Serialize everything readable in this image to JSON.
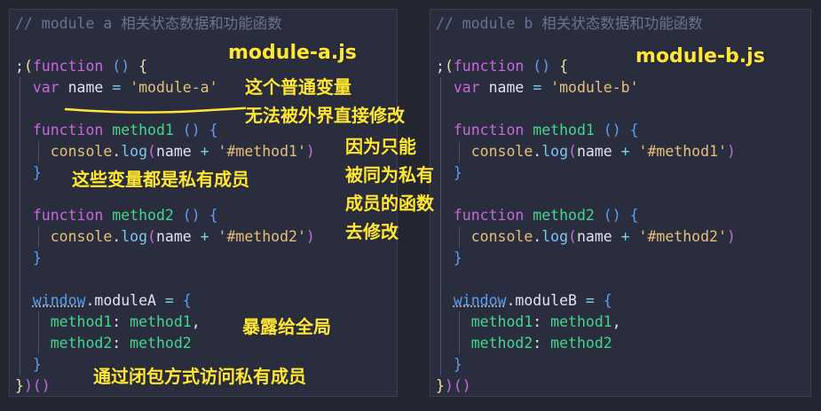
{
  "pane_a": {
    "file_label": "module-a.js",
    "lines": [
      {
        "text": "// module a 相关状态数据和功能函数",
        "style": "cm"
      },
      {
        "text": "",
        "style": "id"
      },
      {
        "tokens": [
          [
            ";",
            "id"
          ],
          [
            "(",
            "pn"
          ],
          [
            "function",
            "kw"
          ],
          [
            " ",
            "id"
          ],
          [
            "()",
            "br"
          ],
          [
            " ",
            "id"
          ],
          [
            "{",
            "pn"
          ]
        ]
      },
      {
        "tokens": [
          [
            "  ",
            "id"
          ],
          [
            "var",
            "kw"
          ],
          [
            " ",
            "id"
          ],
          [
            "name",
            "id"
          ],
          [
            " ",
            "id"
          ],
          [
            "=",
            "op"
          ],
          [
            " ",
            "id"
          ],
          [
            "'module-a'",
            "st"
          ]
        ]
      },
      {
        "text": "",
        "style": "id"
      },
      {
        "tokens": [
          [
            "  ",
            "id"
          ],
          [
            "function",
            "kw"
          ],
          [
            " ",
            "id"
          ],
          [
            "method1",
            "fn"
          ],
          [
            " ",
            "id"
          ],
          [
            "()",
            "br"
          ],
          [
            " ",
            "id"
          ],
          [
            "{",
            "br"
          ]
        ]
      },
      {
        "tokens": [
          [
            "    ",
            "id"
          ],
          [
            "console",
            "ob"
          ],
          [
            ".",
            "id"
          ],
          [
            "log",
            "pr"
          ],
          [
            "(",
            "pm"
          ],
          [
            "name",
            "id"
          ],
          [
            " ",
            "id"
          ],
          [
            "+",
            "op"
          ],
          [
            " ",
            "id"
          ],
          [
            "'#method1'",
            "st"
          ],
          [
            ")",
            "pm"
          ]
        ]
      },
      {
        "tokens": [
          [
            "  ",
            "id"
          ],
          [
            "}",
            "br"
          ]
        ]
      },
      {
        "text": "",
        "style": "id"
      },
      {
        "tokens": [
          [
            "  ",
            "id"
          ],
          [
            "function",
            "kw"
          ],
          [
            " ",
            "id"
          ],
          [
            "method2",
            "fn"
          ],
          [
            " ",
            "id"
          ],
          [
            "()",
            "br"
          ],
          [
            " ",
            "id"
          ],
          [
            "{",
            "br"
          ]
        ]
      },
      {
        "tokens": [
          [
            "    ",
            "id"
          ],
          [
            "console",
            "ob"
          ],
          [
            ".",
            "id"
          ],
          [
            "log",
            "pr"
          ],
          [
            "(",
            "pm"
          ],
          [
            "name",
            "id"
          ],
          [
            " ",
            "id"
          ],
          [
            "+",
            "op"
          ],
          [
            " ",
            "id"
          ],
          [
            "'#method2'",
            "st"
          ],
          [
            ")",
            "pm"
          ]
        ]
      },
      {
        "tokens": [
          [
            "  ",
            "id"
          ],
          [
            "}",
            "br"
          ]
        ]
      },
      {
        "text": "",
        "style": "id"
      },
      {
        "tokens": [
          [
            "  ",
            "id"
          ],
          [
            "window",
            "br"
          ],
          [
            ".",
            "id"
          ],
          [
            "moduleA",
            "id"
          ],
          [
            " ",
            "id"
          ],
          [
            "=",
            "op"
          ],
          [
            " ",
            "id"
          ],
          [
            "{",
            "br"
          ]
        ]
      },
      {
        "tokens": [
          [
            "    ",
            "id"
          ],
          [
            "method1",
            "fn"
          ],
          [
            ":",
            "id"
          ],
          [
            " ",
            "id"
          ],
          [
            "method1",
            "fn"
          ],
          [
            ",",
            "id"
          ]
        ]
      },
      {
        "tokens": [
          [
            "    ",
            "id"
          ],
          [
            "method2",
            "fn"
          ],
          [
            ":",
            "id"
          ],
          [
            " ",
            "id"
          ],
          [
            "method2",
            "fn"
          ]
        ]
      },
      {
        "tokens": [
          [
            "  ",
            "id"
          ],
          [
            "}",
            "br"
          ]
        ]
      },
      {
        "tokens": [
          [
            "}",
            "pn"
          ],
          [
            ")()",
            "pm"
          ]
        ]
      }
    ],
    "annotations": {
      "plain_var": "这个普通变量",
      "no_direct_edit": "无法被外界直接修改",
      "private_members": "这些变量都是私有成员",
      "only_by_private": "因为只能\n被同为私有\n成员的函数\n去修改",
      "expose_global": "暴露给全局",
      "closure_access": "通过闭包方式访问私有成员"
    }
  },
  "pane_b": {
    "file_label": "module-b.js",
    "lines": [
      {
        "text": "// module b 相关状态数据和功能函数",
        "style": "cm"
      },
      {
        "text": "",
        "style": "id"
      },
      {
        "tokens": [
          [
            ";",
            "id"
          ],
          [
            "(",
            "pn"
          ],
          [
            "function",
            "kw"
          ],
          [
            " ",
            "id"
          ],
          [
            "()",
            "br"
          ],
          [
            " ",
            "id"
          ],
          [
            "{",
            "pn"
          ]
        ]
      },
      {
        "tokens": [
          [
            "  ",
            "id"
          ],
          [
            "var",
            "kw"
          ],
          [
            " ",
            "id"
          ],
          [
            "name",
            "id"
          ],
          [
            " ",
            "id"
          ],
          [
            "=",
            "op"
          ],
          [
            " ",
            "id"
          ],
          [
            "'module-b'",
            "st"
          ]
        ]
      },
      {
        "text": "",
        "style": "id"
      },
      {
        "tokens": [
          [
            "  ",
            "id"
          ],
          [
            "function",
            "kw"
          ],
          [
            " ",
            "id"
          ],
          [
            "method1",
            "fn"
          ],
          [
            " ",
            "id"
          ],
          [
            "()",
            "br"
          ],
          [
            " ",
            "id"
          ],
          [
            "{",
            "br"
          ]
        ]
      },
      {
        "tokens": [
          [
            "    ",
            "id"
          ],
          [
            "console",
            "ob"
          ],
          [
            ".",
            "id"
          ],
          [
            "log",
            "pr"
          ],
          [
            "(",
            "pm"
          ],
          [
            "name",
            "id"
          ],
          [
            " ",
            "id"
          ],
          [
            "+",
            "op"
          ],
          [
            " ",
            "id"
          ],
          [
            "'#method1'",
            "st"
          ],
          [
            ")",
            "pm"
          ]
        ]
      },
      {
        "tokens": [
          [
            "  ",
            "id"
          ],
          [
            "}",
            "br"
          ]
        ]
      },
      {
        "text": "",
        "style": "id"
      },
      {
        "tokens": [
          [
            "  ",
            "id"
          ],
          [
            "function",
            "kw"
          ],
          [
            " ",
            "id"
          ],
          [
            "method2",
            "fn"
          ],
          [
            " ",
            "id"
          ],
          [
            "()",
            "br"
          ],
          [
            " ",
            "id"
          ],
          [
            "{",
            "br"
          ]
        ]
      },
      {
        "tokens": [
          [
            "    ",
            "id"
          ],
          [
            "console",
            "ob"
          ],
          [
            ".",
            "id"
          ],
          [
            "log",
            "pr"
          ],
          [
            "(",
            "pm"
          ],
          [
            "name",
            "id"
          ],
          [
            " ",
            "id"
          ],
          [
            "+",
            "op"
          ],
          [
            " ",
            "id"
          ],
          [
            "'#method2'",
            "st"
          ],
          [
            ")",
            "pm"
          ]
        ]
      },
      {
        "tokens": [
          [
            "  ",
            "id"
          ],
          [
            "}",
            "br"
          ]
        ]
      },
      {
        "text": "",
        "style": "id"
      },
      {
        "tokens": [
          [
            "  ",
            "id"
          ],
          [
            "window",
            "br"
          ],
          [
            ".",
            "id"
          ],
          [
            "moduleB",
            "id"
          ],
          [
            " ",
            "id"
          ],
          [
            "=",
            "op"
          ],
          [
            " ",
            "id"
          ],
          [
            "{",
            "br"
          ]
        ]
      },
      {
        "tokens": [
          [
            "    ",
            "id"
          ],
          [
            "method1",
            "fn"
          ],
          [
            ":",
            "id"
          ],
          [
            " ",
            "id"
          ],
          [
            "method1",
            "fn"
          ],
          [
            ",",
            "id"
          ]
        ]
      },
      {
        "tokens": [
          [
            "    ",
            "id"
          ],
          [
            "method2",
            "fn"
          ],
          [
            ":",
            "id"
          ],
          [
            " ",
            "id"
          ],
          [
            "method2",
            "fn"
          ]
        ]
      },
      {
        "tokens": [
          [
            "  ",
            "id"
          ],
          [
            "}",
            "br"
          ]
        ]
      },
      {
        "tokens": [
          [
            "}",
            "pn"
          ],
          [
            ")()",
            "pm"
          ]
        ]
      }
    ]
  },
  "colors": {
    "background": "#242631",
    "pane": "#2a2d3d",
    "annotation": "#ffe733",
    "comment": "#6a7391",
    "keyword": "#c768dd",
    "function_name": "#44d68d",
    "string": "#e5c07b"
  }
}
